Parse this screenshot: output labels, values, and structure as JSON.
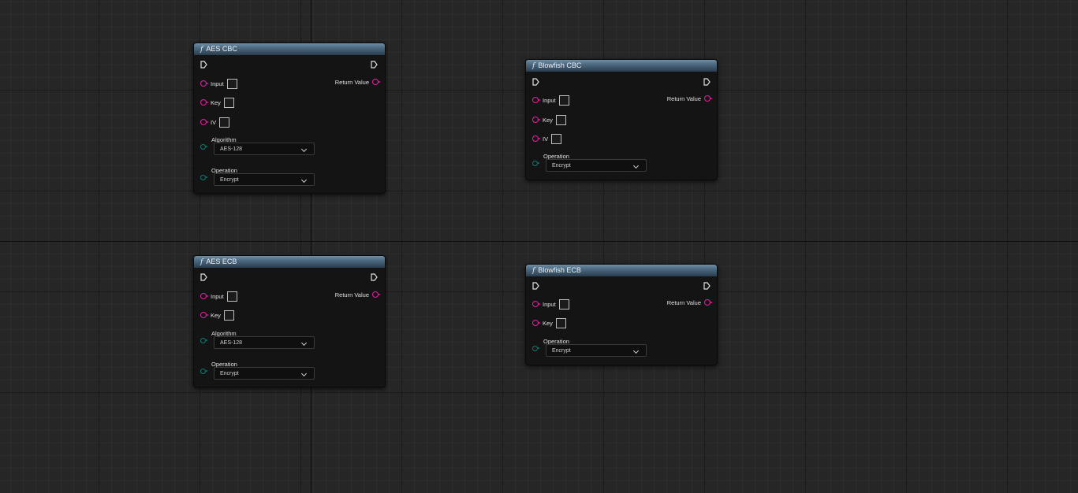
{
  "nodes": {
    "aes_cbc": {
      "title": "AES CBC",
      "inputs": {
        "input": "Input",
        "key": "Key",
        "iv": "IV"
      },
      "return_label": "Return Value",
      "algorithm": {
        "label": "Algorithm",
        "value": "AES-128"
      },
      "operation": {
        "label": "Operation",
        "value": "Encrypt"
      }
    },
    "aes_ecb": {
      "title": "AES ECB",
      "inputs": {
        "input": "Input",
        "key": "Key"
      },
      "return_label": "Return Value",
      "algorithm": {
        "label": "Algorithm",
        "value": "AES-128"
      },
      "operation": {
        "label": "Operation",
        "value": "Encrypt"
      }
    },
    "blowfish_cbc": {
      "title": "Blowfish CBC",
      "inputs": {
        "input": "Input",
        "key": "Key",
        "iv": "IV"
      },
      "return_label": "Return Value",
      "operation": {
        "label": "Operation",
        "value": "Encrypt"
      }
    },
    "blowfish_ecb": {
      "title": "Blowfish ECB",
      "inputs": {
        "input": "Input",
        "key": "Key"
      },
      "return_label": "Return Value",
      "operation": {
        "label": "Operation",
        "value": "Encrypt"
      }
    }
  },
  "colors": {
    "grid_background": "#262626",
    "node_body": "#141414",
    "header_blue": "#4e6c84",
    "data_pin": "#e81ea3",
    "enum_pin": "#0f7c70"
  },
  "icons": {
    "function": "function-icon",
    "exec": "exec-pin-icon",
    "data_pin": "data-pin-icon",
    "enum_pin": "enum-pin-icon",
    "dropdown": "chevron-down-icon"
  }
}
